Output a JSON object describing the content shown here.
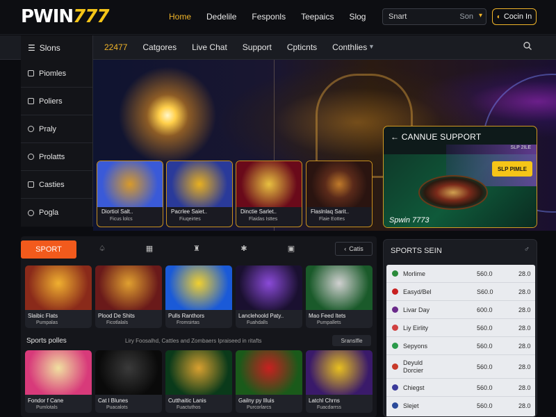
{
  "header": {
    "logo_white": "PWIN",
    "logo_gold": "777",
    "nav": [
      "Home",
      "Dedelile",
      "Fesponls",
      "Teepaics",
      "Slog"
    ],
    "search_placeholder": "Snart",
    "search_button": "Son",
    "login_label": "Cocin In"
  },
  "catbar": {
    "slots_label": "Slons",
    "items": [
      "22477",
      "Catgores",
      "Live Chat",
      "Support",
      "Cpticnts",
      "Conthlies"
    ]
  },
  "sidemenu": [
    "Piomles",
    "Poliers",
    "Praly",
    "Prolatts",
    "Casties",
    "Pogla"
  ],
  "hero_games": [
    {
      "title": "Diortiol Salt..",
      "sub": "Ficus lolcs",
      "c1": "#3a5ad8",
      "c2": "#d89a2a"
    },
    {
      "title": "Pacrlee Saiet..",
      "sub": "Fiuqeirtes",
      "c1": "#2a3a9a",
      "c2": "#e8b020"
    },
    {
      "title": "Dinctie Sarlet..",
      "sub": "Flaidas Isttes",
      "c1": "#6a0a1a",
      "c2": "#e8c040"
    },
    {
      "title": "Flaslnlaq Sarit..",
      "sub": "Flaie Eottes",
      "c1": "#2a1410",
      "c2": "#c07a2a"
    }
  ],
  "support": {
    "title": "CANNUE SUPPORT",
    "subtitle": "SLP 2ILE",
    "cta": "SLP PIMLE",
    "brand": "Spwin 7773"
  },
  "main": {
    "tab_sport": "SPORT",
    "catalog": "Catis",
    "row1": [
      {
        "title": "Slaibic Flats",
        "sub": "Pumpalas",
        "c1": "#8a2a1a",
        "c2": "#f0b030"
      },
      {
        "title": "Plood De Shits",
        "sub": "Ficotlalals",
        "c1": "#e0a030",
        "c2": "#6a1a1a"
      },
      {
        "title": "Pulls Ranthors",
        "sub": "Fromsirtas",
        "c1": "#1a5ad8",
        "c2": "#f0d030"
      },
      {
        "title": "Lanclehoold Paty..",
        "sub": "Fuahdalls",
        "c1": "#1a1030",
        "c2": "#8a4ad8"
      },
      {
        "title": "Mao Feed Itets",
        "sub": "Pumpallets",
        "c1": "#1a5a2a",
        "c2": "#d0d0d0"
      }
    ],
    "subhead": "Sports polles",
    "subnote": "Liry Foosalhd, Cattles and Zombaers Ipraiseed in ritafts",
    "seeall": "Sranslfle",
    "row2": [
      {
        "title": "Fondor f Cane",
        "sub": "Pumlotals",
        "c1": "#d83a7a",
        "c2": "#f0e0a0"
      },
      {
        "title": "Cat l Blunes",
        "sub": "Puacalots",
        "c1": "#0a0a0a",
        "c2": "#3a3a3a"
      },
      {
        "title": "Cutthaitic Lanis",
        "sub": "Fuactuthos",
        "c1": "#0a3a1a",
        "c2": "#d8a030"
      },
      {
        "title": "Gailny py Illuis",
        "sub": "Purcorlarcs",
        "c1": "#1a5a1a",
        "c2": "#c82020"
      },
      {
        "title": "Latchl Chrns",
        "sub": "Fuacdarrss",
        "c1": "#3a1a6a",
        "c2": "#e8c020"
      }
    ]
  },
  "sports": {
    "header": "SPORTS SEIN",
    "rows": [
      {
        "name": "Morlime",
        "a": "560.0",
        "b": "28.0",
        "flag": "#2a8a3a"
      },
      {
        "name": "Easyd/Bel",
        "a": "S60.0",
        "b": "28.0",
        "flag": "#c82020"
      },
      {
        "name": "Livar Day",
        "a": "600.0",
        "b": "28.0",
        "flag": "#6a2a8a"
      },
      {
        "name": "Liy Eirlity",
        "a": "560.0",
        "b": "28.0",
        "flag": "#d04040"
      },
      {
        "name": "Sepyons",
        "a": "560.0",
        "b": "28.0",
        "flag": "#2a9a4a"
      },
      {
        "name": "Deyuld Dorcier",
        "a": "560.0",
        "b": "28.0",
        "flag": "#c83a2a"
      },
      {
        "name": "Chiegst",
        "a": "560.0",
        "b": "28.0",
        "flag": "#3a3a9a"
      },
      {
        "name": "Slejet",
        "a": "560.0",
        "b": "28.0",
        "flag": "#2a4a9a"
      }
    ]
  }
}
